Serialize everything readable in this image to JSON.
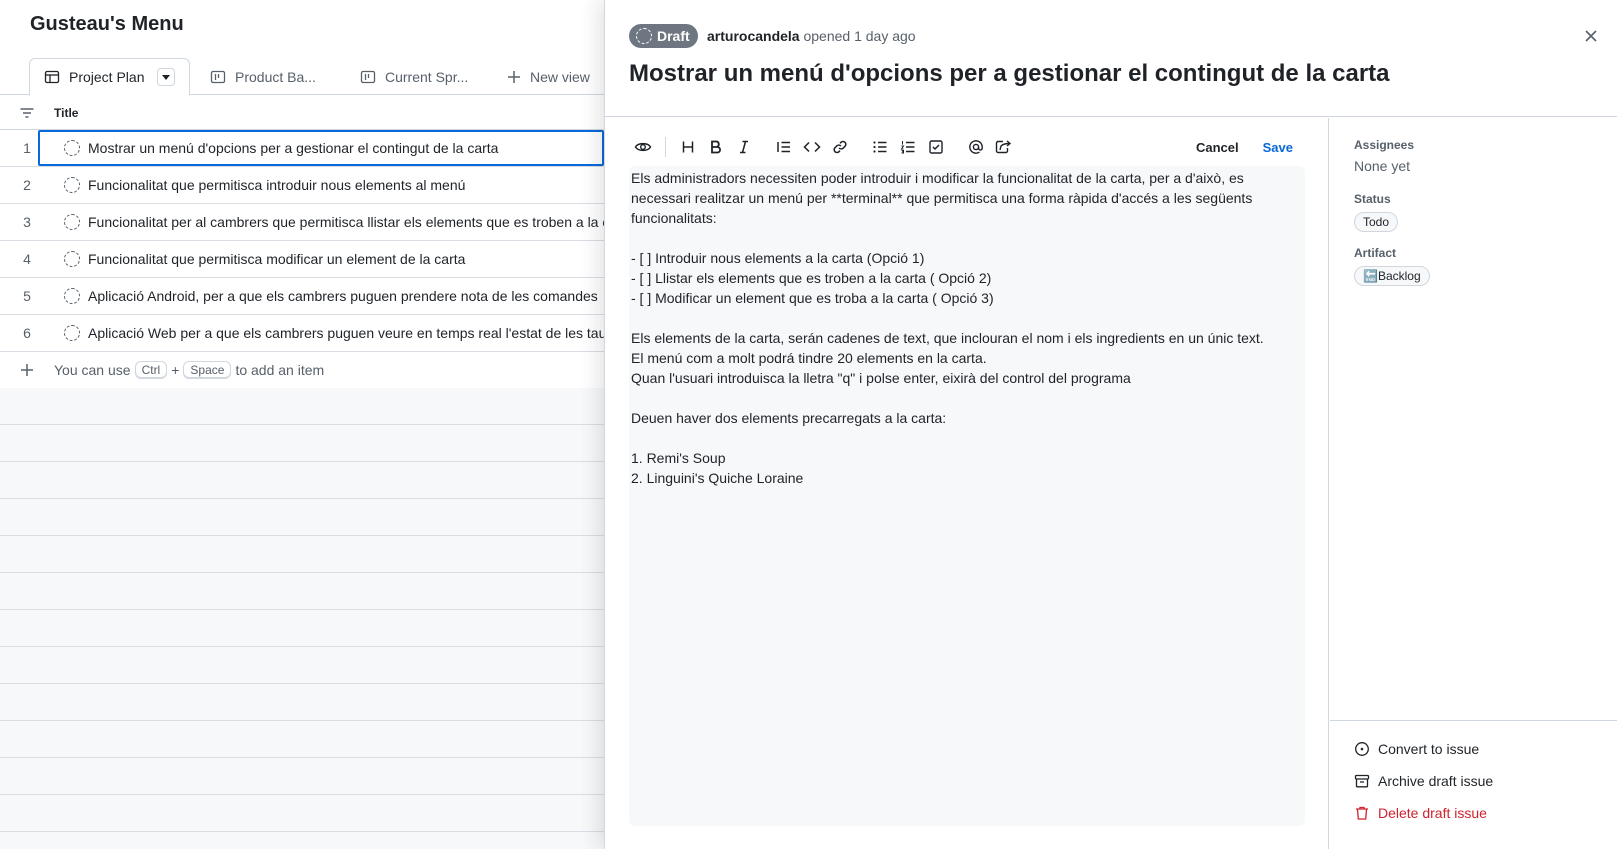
{
  "project": {
    "title": "Gusteau's Menu",
    "tabs": [
      {
        "label": "Project Plan",
        "icon": "table-icon",
        "active": true
      },
      {
        "label": "Product Ba...",
        "icon": "board-icon"
      },
      {
        "label": "Current Spr...",
        "icon": "board-icon"
      }
    ],
    "new_view_label": "New view",
    "column_header": "Title",
    "rows": [
      {
        "num": "1",
        "title": "Mostrar un menú d'opcions per a gestionar el contingut de la carta"
      },
      {
        "num": "2",
        "title": "Funcionalitat que permitisca introduir nous elements al menú"
      },
      {
        "num": "3",
        "title": "Funcionalitat per al cambrers que permitisca llistar els elements que es troben a la carta"
      },
      {
        "num": "4",
        "title": "Funcionalitat que permitisca modificar un element de la carta"
      },
      {
        "num": "5",
        "title": "Aplicació Android, per a que els cambrers puguen prendere nota de les comandes"
      },
      {
        "num": "6",
        "title": "Aplicació Web per a que els cambrers puguen veure en temps real l'estat de les taules"
      }
    ],
    "add_item": {
      "prefix": "You can use",
      "key1": "Ctrl",
      "plus": "+",
      "key2": "Space",
      "suffix": "to add an item"
    }
  },
  "issue": {
    "badge": "Draft",
    "author": "arturocandela",
    "opened": "opened 1 day ago",
    "title": "Mostrar un menú d'opcions per a gestionar el contingut de la carta",
    "cancel_label": "Cancel",
    "save_label": "Save",
    "body": "Els administradors necessiten poder introduir i modificar la funcionalitat de la carta, per a d'això, es necessari realitzar un menú per **terminal** que permitisca una forma ràpida d'accés a les següents funcionalitats:\n\n- [ ] Introduir nous elements a la carta (Opció 1)\n- [ ] Llistar els elements que es troben a la carta ( Opció 2)\n- [ ] Modificar un element que es troba a la carta ( Opció 3)\n\nEls elements de la carta, serán cadenes de text, que inclouran el nom i els ingredients en un únic text.\nEl menú com a molt podrá tindre 20 elements en la carta.\nQuan l'usuari introduisca la lletra \"q\" i polse enter, eixirà del control del programa\n\nDeuen haver dos elements precarregats a la carta:\n\n1. Remi's Soup\n2. Linguini's Quiche Loraine"
  },
  "sidebar": {
    "assignees_label": "Assignees",
    "assignees_value": "None yet",
    "status_label": "Status",
    "status_value": "Todo",
    "artifact_label": "Artifact",
    "artifact_value": "🔚Backlog",
    "actions": {
      "convert": "Convert to issue",
      "archive": "Archive draft issue",
      "delete": "Delete draft issue"
    }
  },
  "colors": {
    "accent": "#0969da",
    "danger": "#cf222e",
    "draft_badge": "#6e7781"
  }
}
